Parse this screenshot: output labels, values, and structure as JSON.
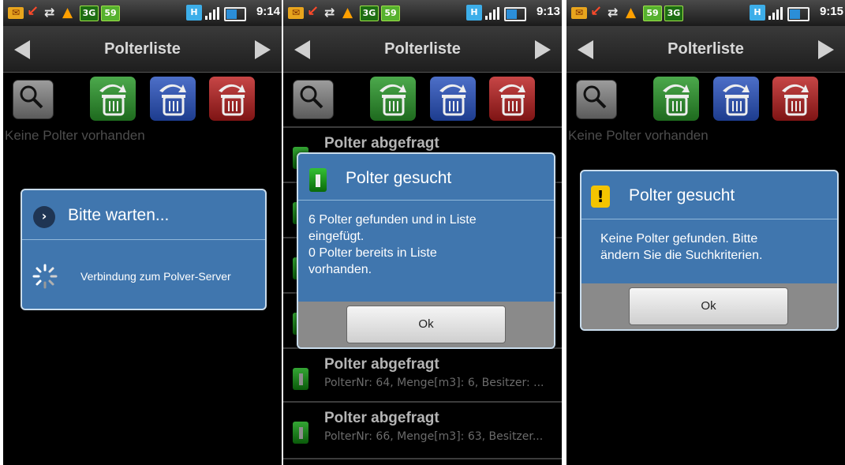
{
  "screens": [
    {
      "status_time": "9:14",
      "status_badges": [
        "3G",
        "59"
      ],
      "title": "Polterliste",
      "empty_text": "Keine Polter vorhanden",
      "dialog": {
        "title": "Bitte warten...",
        "message": "Verbindung zum Polver-Server"
      }
    },
    {
      "status_time": "9:13",
      "status_badges": [
        "3G",
        "59"
      ],
      "title": "Polterliste",
      "list": [
        {
          "title": "Polter abgefragt",
          "subtitle": ""
        },
        {
          "title": "Polter abgefragt",
          "subtitle": "PolterNr: 64, Menge[m3]: 6, Besitzer: ..."
        },
        {
          "title": "Polter abgefragt",
          "subtitle": "PolterNr: 66, Menge[m3]: 63, Besitzer..."
        }
      ],
      "dialog": {
        "title": "Polter gesucht",
        "message_lines": [
          "6 Polter gefunden und in Liste",
          "eingefügt.",
          "0 Polter bereits in Liste",
          "vorhanden."
        ],
        "ok_label": "Ok"
      }
    },
    {
      "status_time": "9:15",
      "status_badges": [
        "59",
        "3G"
      ],
      "title": "Polterliste",
      "empty_text": "Keine Polter vorhanden",
      "dialog": {
        "title": "Polter gesucht",
        "message_lines": [
          "Keine Polter gefunden. Bitte",
          "ändern Sie die Suchkriterien."
        ],
        "ok_label": "Ok",
        "warn_glyph": "!"
      }
    }
  ],
  "icons": {
    "nav_prev": "arrow-left-icon",
    "nav_next": "arrow-right-icon",
    "search": "search-icon",
    "delete_green": "trash-green-icon",
    "delete_blue": "trash-blue-icon",
    "delete_red": "trash-red-icon"
  },
  "status_extra": {
    "hplus": "H"
  },
  "colors": {
    "dialog_bg": "#4076ae",
    "green_btn": "#2e8a2e",
    "blue_btn": "#2f55aa",
    "red_btn": "#a52a2a"
  }
}
